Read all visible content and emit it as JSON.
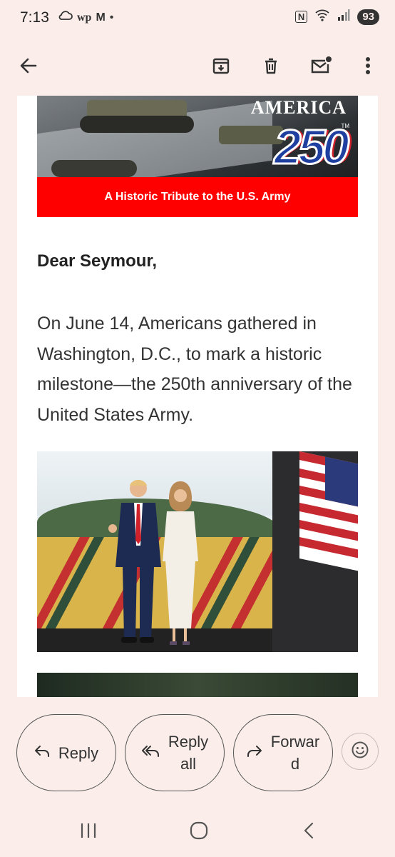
{
  "status_bar": {
    "time": "7:13",
    "left_icons": [
      "cloud-icon",
      "wp-icon",
      "gmail-icon",
      "dot-icon"
    ],
    "left_icon_text": {
      "wp": "wp",
      "gmail": "M",
      "dot": "•"
    },
    "right_icons": [
      "nfc-icon",
      "wifi-icon",
      "signal-icon"
    ],
    "nfc_text": "N",
    "battery": "93"
  },
  "app_bar": {
    "icons": [
      "back-arrow-icon",
      "archive-icon",
      "delete-icon",
      "mark-unread-icon",
      "more-vert-icon"
    ]
  },
  "email": {
    "hero": {
      "brand_word": "AMERICA",
      "brand_number": "250",
      "trademark": "TM",
      "banner": "A Historic Tribute to the U.S. Army"
    },
    "greeting": "Dear Seymour,",
    "body": "On June 14, Americans gathered in Washington, D.C., to mark a historic milestone—the 250th anniversary of the United States Army."
  },
  "actions": {
    "reply": "Reply",
    "reply_all_line1": "Reply",
    "reply_all_line2": "all",
    "forward_line1": "Forwar",
    "forward_line2": "d",
    "reply_icon": "reply-icon",
    "reply_all_icon": "reply-all-icon",
    "forward_icon": "forward-icon",
    "emoji_icon": "emoji-reaction-icon"
  },
  "nav_bar": {
    "items": [
      "recents-icon",
      "home-icon",
      "back-icon"
    ]
  },
  "colors": {
    "background": "#fbeeea",
    "banner_red": "#ff0000",
    "text": "#333333"
  }
}
